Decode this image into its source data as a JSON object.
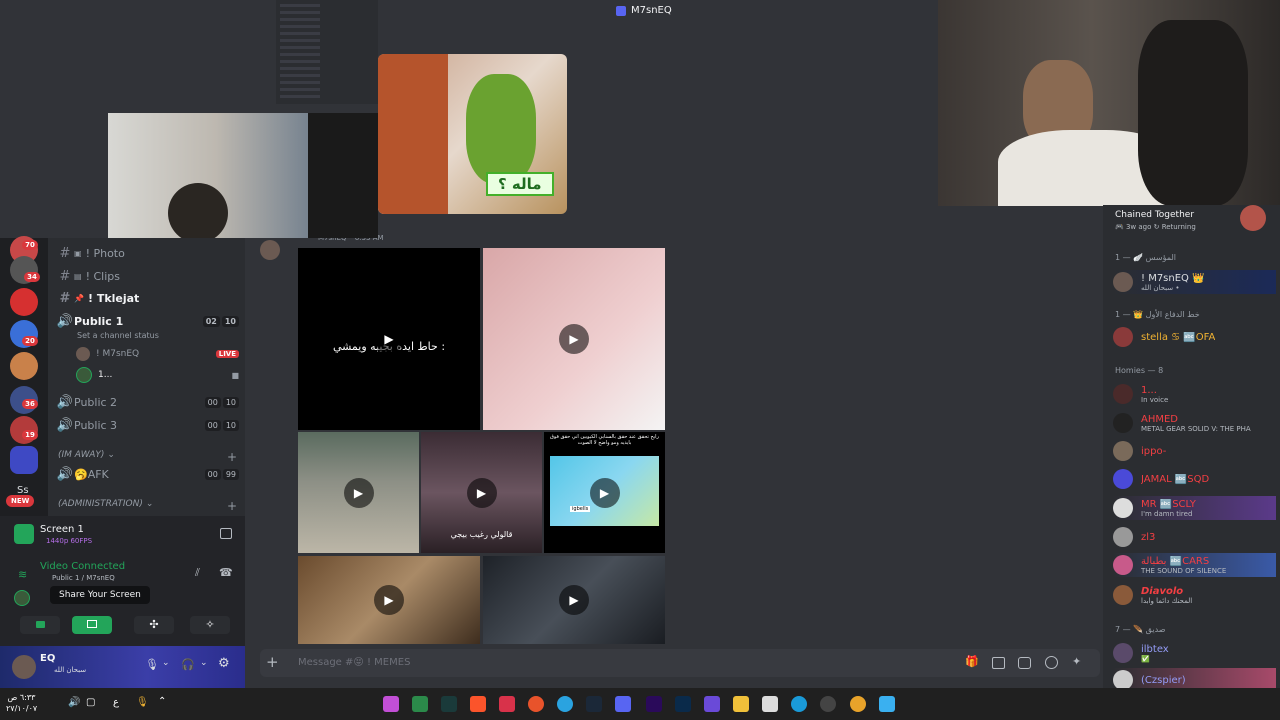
{
  "window_title": "M7snEQ",
  "sticker_text": "ماله ؟",
  "message": {
    "author": "M7snEQ",
    "time": "6:33 AM"
  },
  "video1_text": "حاط ايده بجيبه ويمشي :",
  "video4_caption": "قالولي رغيب بيجي",
  "video5_header": "رايح تحقق عند حقق بالسنابي الكيوبين اني حقق فوق بايديه ومو واضح لا الصوت",
  "video5_label": "igbells",
  "chat_placeholder": "Message #😝 ! MEMES",
  "rail_badges": [
    "70",
    "34",
    "20",
    "36",
    "19",
    "NEW"
  ],
  "rail_ss": "Ss",
  "channels": [
    {
      "name": "! Photo",
      "type": "text",
      "icon": "photo-icon"
    },
    {
      "name": "! Clips",
      "type": "text",
      "icon": "film-icon"
    },
    {
      "name": "! Tklejat",
      "type": "text",
      "icon": "pin-icon",
      "bold": true
    },
    {
      "name": "Public 1",
      "type": "voice",
      "bold": true,
      "counts": [
        "02",
        "10"
      ]
    },
    {
      "name": "Public 2",
      "type": "voice",
      "counts": [
        "00",
        "10"
      ]
    },
    {
      "name": "Public 3",
      "type": "voice",
      "counts": [
        "00",
        "10"
      ]
    },
    {
      "name": "🥱AFK",
      "type": "voice",
      "counts": [
        "00",
        "99"
      ]
    }
  ],
  "channel_status": "Set a channel status",
  "voice_users": [
    {
      "name": "! M7snEQ",
      "live": "LIVE"
    },
    {
      "name": "1..."
    }
  ],
  "categories": [
    "(IM AWAY)",
    "(ADMINISTRATION)"
  ],
  "screen": {
    "title": "Screen 1",
    "quality": "1440p 60FPS"
  },
  "voice": {
    "status": "Video Connected",
    "channel": "Public 1 / M7snEQ"
  },
  "tooltip": "Share Your Screen",
  "user": {
    "name": "EQ",
    "status": "سبحان الله"
  },
  "activity": {
    "game": "Chained Together",
    "time": "3w ago",
    "state": "Returning"
  },
  "member_groups": [
    {
      "label": "المؤسس 🪽 — 1",
      "members": [
        {
          "name": "! M7snEQ 👑",
          "sub": "سبحان الله •",
          "color": "#f2f3f5"
        }
      ]
    },
    {
      "label": "خط الدفاع الأول 👑 — 1",
      "members": [
        {
          "name": "stella ♋ 🔤OFA",
          "sub": "",
          "color": "#f0b232"
        }
      ]
    },
    {
      "label": "Homies — 8",
      "members": [
        {
          "name": "1...",
          "sub": "In voice",
          "color": "#f23f43"
        },
        {
          "name": "AHMED",
          "sub": "METAL GEAR SOLID V: THE PHA",
          "color": "#f23f43"
        },
        {
          "name": "ippo-",
          "sub": "",
          "color": "#f23f43"
        },
        {
          "name": "JAMAL 🔤SQD",
          "sub": "",
          "color": "#f23f43"
        },
        {
          "name": "MR 🔤SCLY",
          "sub": "I'm damn tired",
          "color": "#f23f43"
        },
        {
          "name": "zl3",
          "sub": "",
          "color": "#f23f43"
        },
        {
          "name": "بطبالة 🔤CARS",
          "sub": "THE SOUND OF SILENCE",
          "color": "#f23f43"
        },
        {
          "name": "Diavolo",
          "sub": "المحنك دائما وابدا",
          "color": "#f23f43"
        }
      ]
    },
    {
      "label": "صديق 🪶 — 7",
      "members": [
        {
          "name": "ilbtex",
          "sub": "✅",
          "color": "#949cf7"
        },
        {
          "name": "(Czspier)",
          "sub": "",
          "color": "#949cf7"
        }
      ]
    }
  ],
  "taskbar": {
    "time": "٦:٣٣ ص",
    "date": "٢٧/١٠/٠٧",
    "lang": "ع"
  }
}
